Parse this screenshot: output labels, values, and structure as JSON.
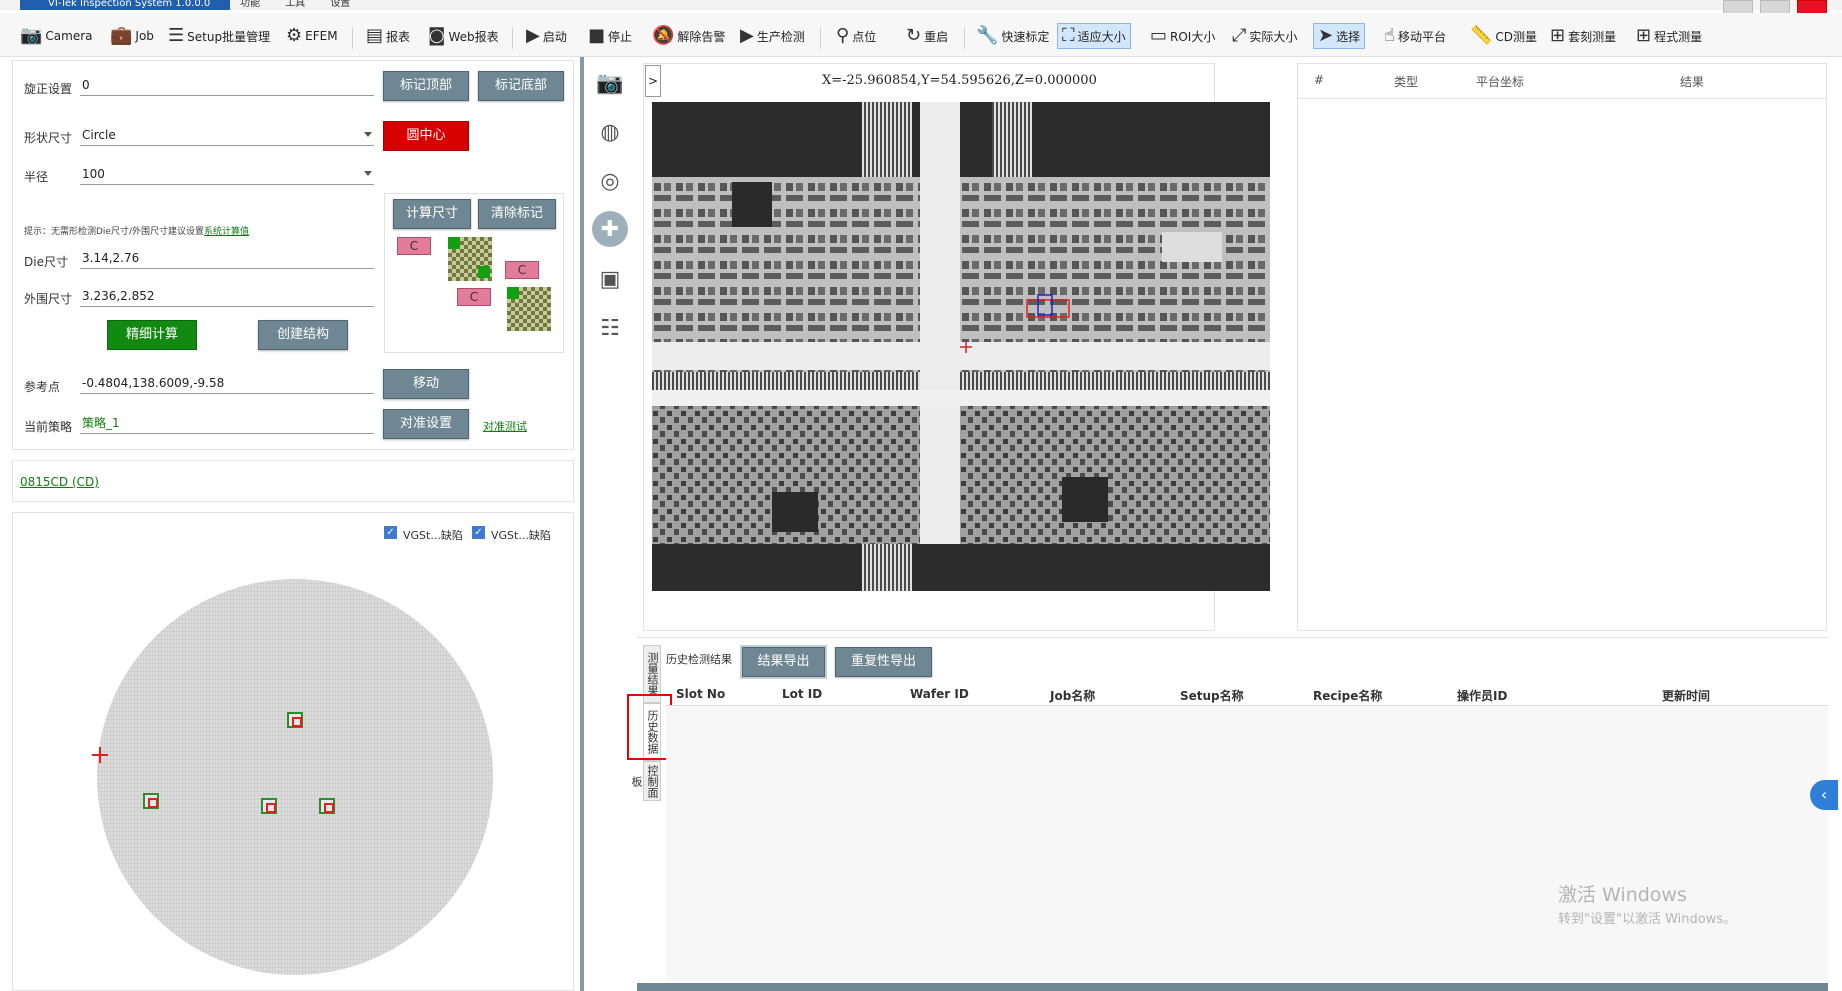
{
  "app": {
    "title": "VI-Tek Inspection System 1.0.0.0",
    "menu": [
      "功能",
      "工具",
      "设置"
    ]
  },
  "toolbar": {
    "items": [
      {
        "label": "Camera",
        "icon": "camera-icon"
      },
      {
        "label": "Job",
        "icon": "briefcase-icon"
      },
      {
        "label": "Setup批量管理",
        "icon": "list-icon"
      },
      {
        "label": "EFEM",
        "icon": "robot-arm-icon"
      },
      {
        "label": "报表",
        "icon": "report-icon"
      },
      {
        "label": "Web报表",
        "icon": "web-report-icon"
      },
      {
        "label": "启动",
        "icon": "play-icon"
      },
      {
        "label": "停止",
        "icon": "stop-icon"
      },
      {
        "label": "解除告警",
        "icon": "bell-off-icon"
      },
      {
        "label": "生产检测",
        "icon": "play-icon"
      },
      {
        "label": "点位",
        "icon": "pin-icon"
      },
      {
        "label": "重启",
        "icon": "restart-icon"
      },
      {
        "label": "快速标定",
        "icon": "wrench-icon"
      },
      {
        "label": "适应大小",
        "icon": "fit-icon"
      },
      {
        "label": "ROI大小",
        "icon": "roi-icon"
      },
      {
        "label": "实际大小",
        "icon": "expand-icon"
      },
      {
        "label": "选择",
        "icon": "cursor-icon"
      },
      {
        "label": "移动平台",
        "icon": "hand-icon"
      },
      {
        "label": "CD测量",
        "icon": "ruler-icon"
      },
      {
        "label": "套刻测量",
        "icon": "plus-box-icon"
      },
      {
        "label": "程式测量",
        "icon": "plus-box-icon"
      }
    ]
  },
  "left": {
    "rotation_label": "旋正设置",
    "rotation_value": "0",
    "mark_top": "标记顶部",
    "mark_bottom": "标记底部",
    "shape_label": "形状尺寸",
    "shape_value": "Circle",
    "circle_center": "圆中心",
    "radius_label": "半径",
    "radius_value": "100",
    "hint_prefix": "提示：无需形检测Die尺寸/外围尺寸建议设置",
    "hint_link": "系统计算值",
    "die_size_label": "Die尺寸",
    "die_size_value": "3.14,2.76",
    "outer_size_label": "外围尺寸",
    "outer_size_value": "3.236,2.852",
    "calc_fine": "精细计算",
    "create_struct": "创建结构",
    "calc_size": "计算尺寸",
    "clear_marks": "清除标记",
    "mark_c": "C",
    "ref_label": "参考点",
    "ref_value": "-0.4804,138.6009,-9.58",
    "move": "移动",
    "strategy_label": "当前策略",
    "strategy_value": "策略_1",
    "align_settings": "对准设置",
    "align_test": "对准测试",
    "recipe_link": "0815CD (CD)",
    "check1": "VGSt...缺陷",
    "check2": "VGSt...缺陷"
  },
  "viewer": {
    "expand": ">",
    "coords": "X=-25.960854,Y=54.595626,Z=0.000000"
  },
  "results_table": {
    "columns": [
      "#",
      "类型",
      "平台坐标",
      "结果"
    ]
  },
  "history": {
    "title": "历史检测结果",
    "export_btn": "结果导出",
    "repeat_export_btn": "重复性导出",
    "vtabs": [
      "测量结果",
      "历史数据",
      "控制面板"
    ],
    "columns": [
      "Slot No",
      "Lot ID",
      "Wafer ID",
      "Job名称",
      "Setup名称",
      "Recipe名称",
      "操作员ID",
      "更新时间"
    ]
  },
  "watermark": {
    "line1": "激活 Windows",
    "line2": "转到\"设置\"以激活 Windows。"
  }
}
